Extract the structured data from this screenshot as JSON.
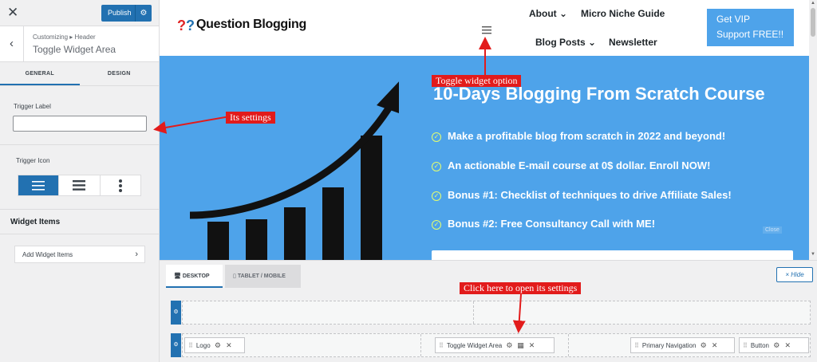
{
  "panel": {
    "close_icon": "close-icon",
    "publish_label": "Publish",
    "crumb": "Customizing ▸ Header",
    "title": "Toggle Widget Area",
    "tabs": [
      "GENERAL",
      "DESIGN"
    ],
    "trigger_label": "Trigger Label",
    "trigger_value": "",
    "trigger_icon_label": "Trigger Icon",
    "icon_options": [
      "hamburger-icon",
      "bars-icon",
      "vertical-dots-icon"
    ],
    "widget_items_heading": "Widget Items",
    "add_widget_label": "Add Widget Items"
  },
  "site": {
    "logo_text": "Question Blogging",
    "nav": {
      "about": "About ⌄",
      "micro": "Micro Niche Guide",
      "blog": "Blog Posts ⌄",
      "newsletter": "Newsletter"
    },
    "vip_line1": "Get VIP",
    "vip_line2": "Support FREE!!",
    "hero_title": "10-Days Blogging From Scratch Course",
    "hero_items": [
      "Make a profitable blog from scratch in 2022 and beyond!",
      "An actionable E-mail course at 0$ dollar. Enroll NOW!",
      "Bonus #1: Checklist of techniques to drive Affiliate Sales!",
      "Bonus #2: Free Consultancy Call with ME!"
    ],
    "close_tag": "Close"
  },
  "builder": {
    "desktop_tab": "DESKTOP",
    "tablet_tab": "TABLET / MOBILE",
    "hide_label": "× Hide",
    "chips": {
      "logo": "Logo",
      "toggle": "Toggle Widget Area",
      "primary_nav": "Primary Navigation",
      "button": "Button"
    }
  },
  "annotations": {
    "toggle_option": "Toggle widget option",
    "its_settings": "Its settings",
    "click_here": "Click here to open its settings"
  },
  "colors": {
    "accent": "#2271b1",
    "hero_bg": "#4ea3ea",
    "annotation_red": "#e21b1b"
  }
}
